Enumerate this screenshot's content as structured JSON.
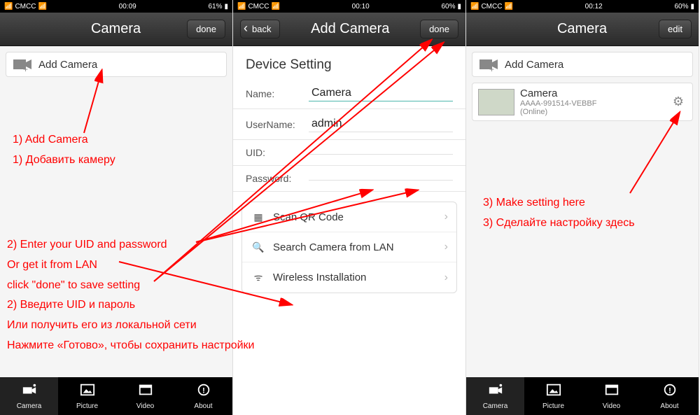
{
  "screen1": {
    "status": {
      "carrier": "CMCC",
      "time": "00:09",
      "battery": "61%"
    },
    "nav": {
      "title": "Camera",
      "done": "done"
    },
    "addCamera": "Add Camera",
    "tabs": {
      "camera": "Camera",
      "picture": "Picture",
      "video": "Video",
      "about": "About"
    }
  },
  "screen2": {
    "status": {
      "carrier": "CMCC",
      "time": "00:10",
      "battery": "60%"
    },
    "nav": {
      "back": "back",
      "title": "Add Camera",
      "done": "done"
    },
    "header": "Device Setting",
    "form": {
      "nameLabel": "Name:",
      "nameValue": "Camera",
      "userLabel": "UserName:",
      "userValue": "admin",
      "uidLabel": "UID:",
      "uidValue": "",
      "pwdLabel": "Password:",
      "pwdValue": ""
    },
    "options": {
      "scan": "Scan QR Code",
      "search": "Search Camera from LAN",
      "wireless": "Wireless Installation"
    }
  },
  "screen3": {
    "status": {
      "carrier": "CMCC",
      "time": "00:12",
      "battery": "60%"
    },
    "nav": {
      "title": "Camera",
      "edit": "edit"
    },
    "addCamera": "Add Camera",
    "camera": {
      "name": "Camera",
      "uid": "AAAA-991514-VEBBF",
      "status": "(Online)"
    },
    "tabs": {
      "camera": "Camera",
      "picture": "Picture",
      "video": "Video",
      "about": "About"
    }
  },
  "annotations": {
    "s1_1": "1) Add Camera",
    "s1_2": "1) Добавить камеру",
    "s2_1": "2) Enter your UID and password",
    "s2_2": "Or get it from LAN",
    "s2_3": "click \"done\" to save setting",
    "s2_4": "2) Введите UID и пароль",
    "s2_5": "Или получить его из локальной сети",
    "s2_6": "Нажмите «Готово», чтобы сохранить настройки",
    "s3_1": "3) Make setting here",
    "s3_2": "3) Сделайте настройку здесь"
  }
}
